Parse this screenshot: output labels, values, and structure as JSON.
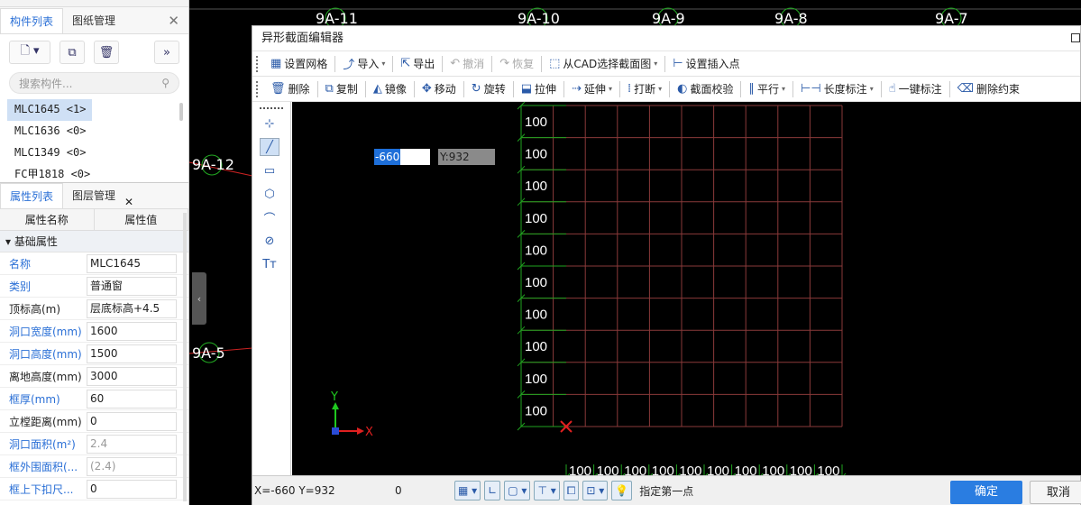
{
  "background_grid_labels": [
    "9A-11",
    "9A-10",
    "9A-9",
    "9A-8",
    "9A-7",
    "9A-12",
    "9A-5"
  ],
  "left_panel": {
    "component_tabs": [
      "构件列表",
      "图纸管理"
    ],
    "search_placeholder": "搜索构件...",
    "components": [
      "MLC1645 <1>",
      "MLC1636 <0>",
      "MLC1349 <0>",
      "FC甲1818 <0>"
    ],
    "property_tabs": [
      "属性列表",
      "图层管理"
    ],
    "property_headers": [
      "属性名称",
      "属性值"
    ],
    "group_label": "基础属性",
    "properties": [
      {
        "name": "名称",
        "value": "MLC1645",
        "blue": true,
        "gray": false
      },
      {
        "name": "类别",
        "value": "普通窗",
        "blue": true,
        "gray": false
      },
      {
        "name": "顶标高(m)",
        "value": "层底标高+4.5",
        "blue": false,
        "gray": false
      },
      {
        "name": "洞口宽度(mm)",
        "value": "1600",
        "blue": true,
        "gray": false
      },
      {
        "name": "洞口高度(mm)",
        "value": "1500",
        "blue": true,
        "gray": false
      },
      {
        "name": "离地高度(mm)",
        "value": "3000",
        "blue": false,
        "gray": false
      },
      {
        "name": "框厚(mm)",
        "value": "60",
        "blue": true,
        "gray": false
      },
      {
        "name": "立樘距离(mm)",
        "value": "0",
        "blue": false,
        "gray": false
      },
      {
        "name": "洞口面积(m²)",
        "value": "2.4",
        "blue": true,
        "gray": true
      },
      {
        "name": "框外围面积(...",
        "value": "(2.4)",
        "blue": true,
        "gray": true
      },
      {
        "name": "框上下扣尺...",
        "value": "0",
        "blue": true,
        "gray": false
      }
    ]
  },
  "dialog": {
    "title": "异形截面编辑器",
    "toolbar1": [
      {
        "icon": "grid-icon",
        "glyph": "▦",
        "label": "设置网格",
        "disabled": false,
        "dropdown": false
      },
      {
        "icon": "import-icon",
        "glyph": "⤴",
        "label": "导入",
        "disabled": false,
        "dropdown": true
      },
      {
        "icon": "export-icon",
        "glyph": "⇱",
        "label": "导出",
        "disabled": false,
        "dropdown": false
      },
      {
        "icon": "undo-icon",
        "glyph": "↶",
        "label": "撤消",
        "disabled": true,
        "dropdown": false
      },
      {
        "icon": "redo-icon",
        "glyph": "↷",
        "label": "恢复",
        "disabled": true,
        "dropdown": false
      },
      {
        "icon": "cad-select-icon",
        "glyph": "⬚",
        "label": "从CAD选择截面图",
        "disabled": false,
        "dropdown": true
      },
      {
        "icon": "insert-point-icon",
        "glyph": "⊢",
        "label": "设置插入点",
        "disabled": false,
        "dropdown": false
      }
    ],
    "toolbar2": [
      {
        "icon": "delete-icon",
        "glyph": "🗑",
        "label": "删除",
        "dropdown": false
      },
      {
        "icon": "copy-icon",
        "glyph": "⧉",
        "label": "复制",
        "dropdown": false
      },
      {
        "icon": "mirror-icon",
        "glyph": "◭",
        "label": "镜像",
        "dropdown": false
      },
      {
        "icon": "move-icon",
        "glyph": "✥",
        "label": "移动",
        "dropdown": false
      },
      {
        "icon": "rotate-icon",
        "glyph": "↻",
        "label": "旋转",
        "dropdown": false
      },
      {
        "icon": "stretch-icon",
        "glyph": "⬓",
        "label": "拉伸",
        "dropdown": false
      },
      {
        "icon": "extend-icon",
        "glyph": "⇢",
        "label": "延伸",
        "dropdown": true
      },
      {
        "icon": "break-icon",
        "glyph": "⁞",
        "label": "打断",
        "dropdown": true
      },
      {
        "icon": "check-icon",
        "glyph": "◐",
        "label": "截面校验",
        "dropdown": false
      },
      {
        "icon": "parallel-icon",
        "glyph": "∥",
        "label": "平行",
        "dropdown": true
      },
      {
        "icon": "length-dim-icon",
        "glyph": "⊢⊣",
        "label": "长度标注",
        "dropdown": true
      },
      {
        "icon": "one-key-dim-icon",
        "glyph": "☝",
        "label": "一键标注",
        "dropdown": false
      },
      {
        "icon": "delete-constraint-icon",
        "glyph": "⌫",
        "label": "删除约束",
        "dropdown": false
      }
    ],
    "side_tools": [
      {
        "icon": "point-icon",
        "glyph": "⊹"
      },
      {
        "icon": "line-icon",
        "glyph": "╱"
      },
      {
        "icon": "rectangle-icon",
        "glyph": "▭"
      },
      {
        "icon": "polygon-icon",
        "glyph": "⬡"
      },
      {
        "icon": "arc-icon",
        "glyph": "⌒"
      },
      {
        "icon": "circle-icon",
        "glyph": "⊘"
      },
      {
        "icon": "text-icon",
        "glyph": "Tт"
      }
    ],
    "x_input": "-660",
    "y_display": "Y:932",
    "grid_row_labels": [
      "100",
      "100",
      "100",
      "100",
      "100",
      "100",
      "100",
      "100",
      "100",
      "100"
    ],
    "grid_col_labels": [
      "100",
      "100",
      "100",
      "100",
      "100",
      "100",
      "100",
      "100",
      "100",
      "100"
    ],
    "axis_x": "X",
    "axis_y": "Y",
    "status": {
      "coords": "X=-660 Y=932",
      "value": "0",
      "hint": "指定第一点",
      "ok": "确定",
      "cancel": "取消"
    }
  },
  "colors": {
    "grid_line": "#8a3a3a",
    "tick": "#1fa31f",
    "accent": "#2a7de1"
  }
}
